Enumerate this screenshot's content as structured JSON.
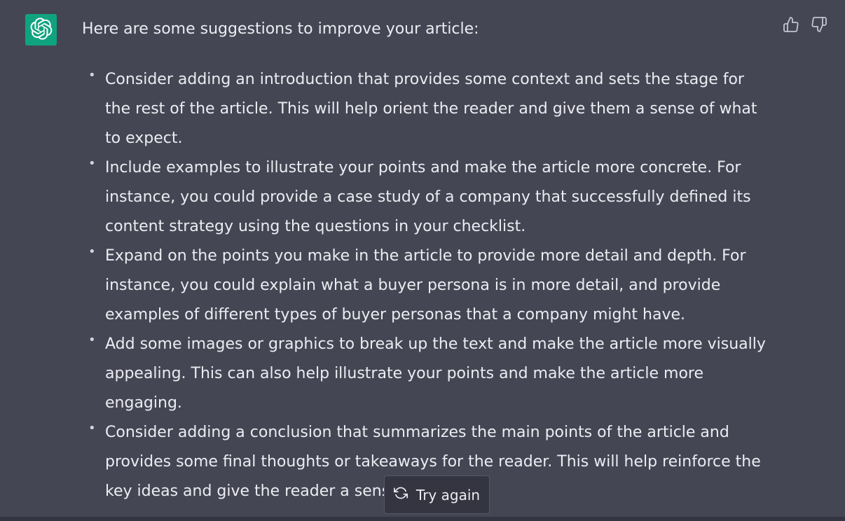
{
  "colors": {
    "background": "#444654",
    "avatar_bg": "#10a37f",
    "text": "#ececf1",
    "icon": "#c5c5d2",
    "button_bg": "#343541",
    "button_border": "#565869"
  },
  "message": {
    "avatar_icon": "openai-logo-icon",
    "intro": "Here are some suggestions to improve your article:",
    "suggestions": [
      "Consider adding an introduction that provides some context and sets the stage for the rest of the article. This will help orient the reader and give them a sense of what to expect.",
      "Include examples to illustrate your points and make the article more concrete. For instance, you could provide a case study of a company that successfully defined its content strategy using the questions in your checklist.",
      "Expand on the points you make in the article to provide more detail and depth. For instance, you could explain what a buyer persona is in more detail, and provide examples of different types of buyer personas that a company might have.",
      "Add some images or graphics to break up the text and make the article more visually appealing. This can also help illustrate your points and make the article more engaging.",
      "Consider adding a conclusion that summarizes the main points of the article and provides some final thoughts or takeaways for the reader. This will help reinforce the key ideas and give the reader a sense of closure."
    ]
  },
  "feedback": {
    "thumbs_up_icon": "thumbs-up-icon",
    "thumbs_down_icon": "thumbs-down-icon"
  },
  "try_again": {
    "label": "Try again",
    "icon": "refresh-icon"
  }
}
